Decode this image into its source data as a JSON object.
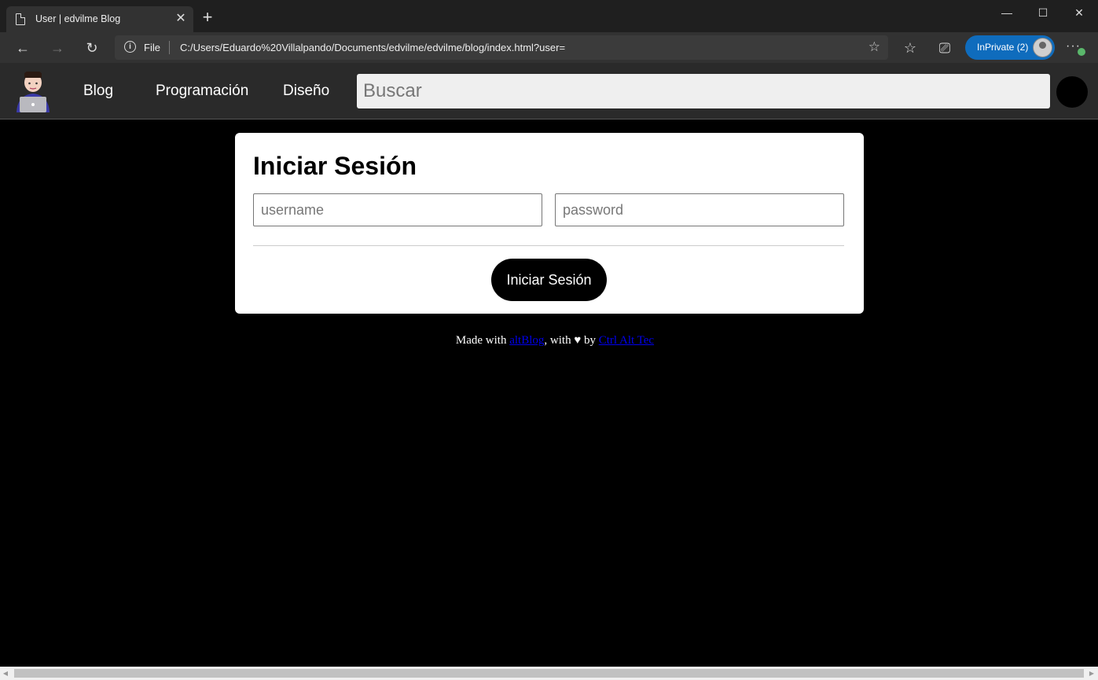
{
  "browser": {
    "tab_title": "User | edvilme Blog",
    "address_scheme": "File",
    "url": "C:/Users/Eduardo%20Villalpando/Documents/edvilme/edvilme/blog/index.html?user=",
    "inprivate_label": "InPrivate (2)",
    "accent_color": "#0f6cbd"
  },
  "nav": {
    "links": [
      "Blog",
      "Programación",
      "Diseño"
    ],
    "search_placeholder": "Buscar",
    "logo_icon": "technologist-emoji"
  },
  "login": {
    "title": "Iniciar Sesión",
    "username_placeholder": "username",
    "password_placeholder": "password",
    "submit_label": "Iniciar Sesión"
  },
  "footer": {
    "prefix": "Made with ",
    "link1": "altBlog",
    "middle": ", with ",
    "heart_icon": "heart-icon",
    "by": " by ",
    "link2": "Ctrl Alt Tec"
  }
}
